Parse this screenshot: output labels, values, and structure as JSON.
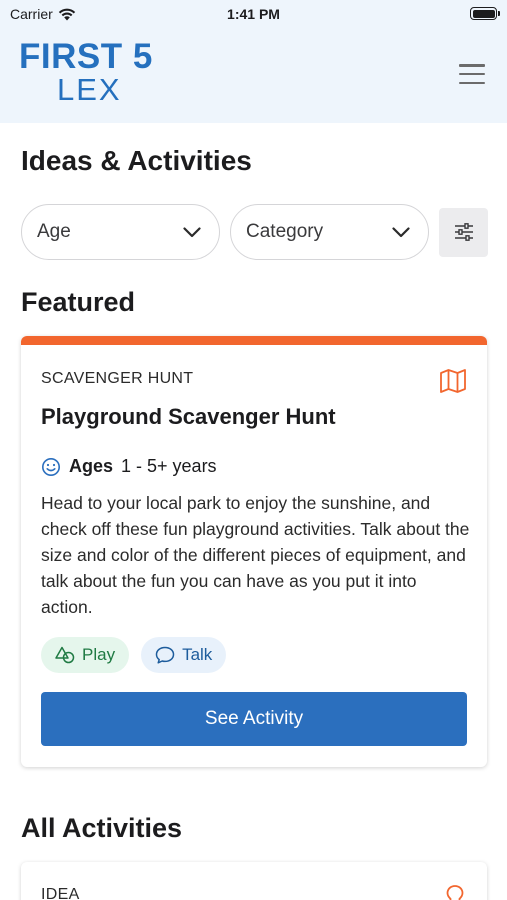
{
  "status_bar": {
    "carrier": "Carrier",
    "time": "1:41 PM"
  },
  "header": {
    "logo_line1": "FIRST 5",
    "logo_line2": "LEX",
    "menu_icon": "hamburger-menu-icon"
  },
  "page_title": "Ideas & Activities",
  "filters": {
    "age": {
      "value": "Age"
    },
    "category": {
      "value": "Category"
    },
    "options_icon": "sliders-icon"
  },
  "featured": {
    "heading": "Featured",
    "accent_color": "#f2662e",
    "card": {
      "category": "SCAVENGER HUNT",
      "type_icon": "map-icon",
      "title": "Playground Scavenger Hunt",
      "ages_label": "Ages",
      "ages_value": "1 - 5+ years",
      "description": "Head to your local park to enjoy the sunshine, and check off these fun playground activities. Talk about the size and color of the different pieces of equipment, and talk about the fun you can have as you put it into action.",
      "tags": [
        {
          "label": "Play",
          "icon": "shapes-icon"
        },
        {
          "label": "Talk",
          "icon": "chat-icon"
        }
      ],
      "cta_label": "See Activity"
    }
  },
  "all_activities": {
    "heading": "All Activities",
    "first_card": {
      "category": "IDEA",
      "type_icon": "lightbulb-icon"
    }
  },
  "colors": {
    "brand_blue": "#2570be",
    "button_blue": "#2b6fbe",
    "featured_orange": "#f2662e"
  }
}
